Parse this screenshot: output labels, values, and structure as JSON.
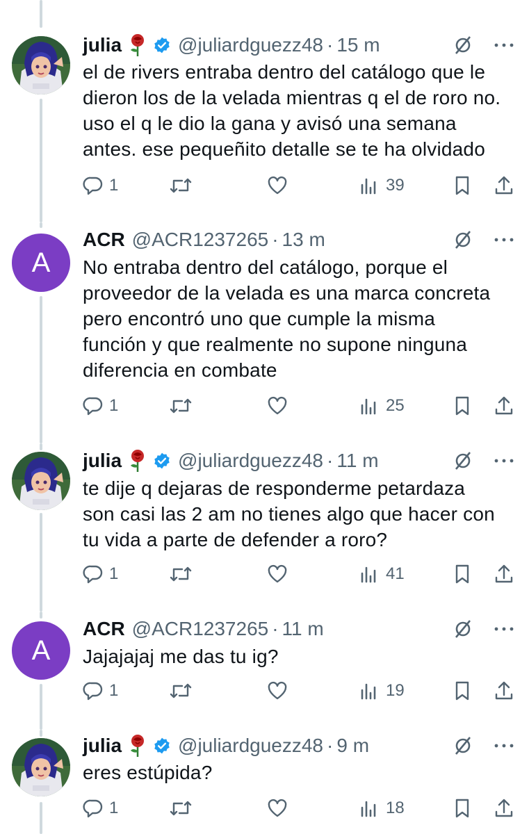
{
  "tweets": [
    {
      "name": "julia",
      "emoji": "rose",
      "verified": true,
      "handle": "@juliardguezz48",
      "time": "15 m",
      "text": "el de rivers entraba dentro del catálogo que le\ndieron los de la velada mientras q el de roro no.\nuso el q le dio la gana y avisó una semana\nantes. ese pequeñito detalle se te ha olvidado",
      "replies": "1",
      "views": "39"
    },
    {
      "name": "ACR",
      "avatar_letter": "A",
      "verified": false,
      "handle": "@ACR1237265",
      "time": "13 m",
      "text": "No entraba dentro del catálogo, porque el\nproveedor de la velada es una marca concreta\npero encontró uno que cumple la misma\nfunción y que realmente no supone ninguna\ndiferencia en combate",
      "replies": "1",
      "views": "25"
    },
    {
      "name": "julia",
      "emoji": "rose",
      "verified": true,
      "handle": "@juliardguezz48",
      "time": "11 m",
      "text": "te dije q dejaras de responderme petardaza\nson casi las 2 am no tienes algo que hacer con\ntu vida a parte de defender a roro?",
      "replies": "1",
      "views": "41"
    },
    {
      "name": "ACR",
      "avatar_letter": "A",
      "verified": false,
      "handle": "@ACR1237265",
      "time": "11 m",
      "text": "Jajajajaj me das tu ig?",
      "replies": "1",
      "views": "19"
    },
    {
      "name": "julia",
      "emoji": "rose",
      "verified": true,
      "handle": "@juliardguezz48",
      "time": "9 m",
      "text": "eres estúpida?",
      "replies": "1",
      "views": "18"
    }
  ],
  "colors": {
    "text": "#0f1419",
    "secondary": "#536471",
    "thread_line": "#cfd9de",
    "verified": "#1d9bf0",
    "avatar_letter_bg": "#7b3dc4"
  },
  "icons": [
    "reply-icon",
    "retweet-icon",
    "like-icon",
    "views-icon",
    "bookmark-icon",
    "share-icon",
    "grok-icon",
    "more-icon",
    "verified-badge-icon",
    "rose-emoji-icon"
  ]
}
